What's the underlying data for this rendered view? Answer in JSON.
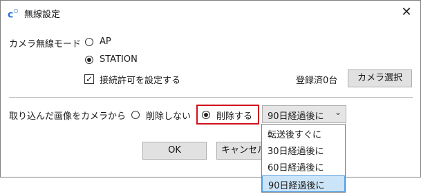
{
  "window": {
    "title": "無線設定",
    "icon": "camera-connect-icon",
    "close_glyph": "✕"
  },
  "mode": {
    "label": "カメラ無線モード",
    "options": [
      {
        "label": "AP",
        "selected": false
      },
      {
        "label": "STATION",
        "selected": true
      }
    ]
  },
  "permission": {
    "checkbox_label": "接続許可を設定する",
    "checked": true,
    "registered_text": "登録済0台",
    "select_camera_button": "カメラ選択"
  },
  "import": {
    "label": "取り込んだ画像をカメラから",
    "options": [
      {
        "label": "削除しない",
        "selected": false
      },
      {
        "label": "削除する",
        "selected": true
      }
    ],
    "timing": {
      "selected": "90日経過後に",
      "options": [
        "転送後すぐに",
        "30日経過後に",
        "60日経過後に",
        "90日経過後に"
      ],
      "highlighted_index": 3
    }
  },
  "footer": {
    "ok_label": "OK",
    "cancel_label": "キャンセル"
  },
  "colors": {
    "highlight_border": "#d0101b",
    "dropdown_selected_bg": "#cce4f7"
  }
}
